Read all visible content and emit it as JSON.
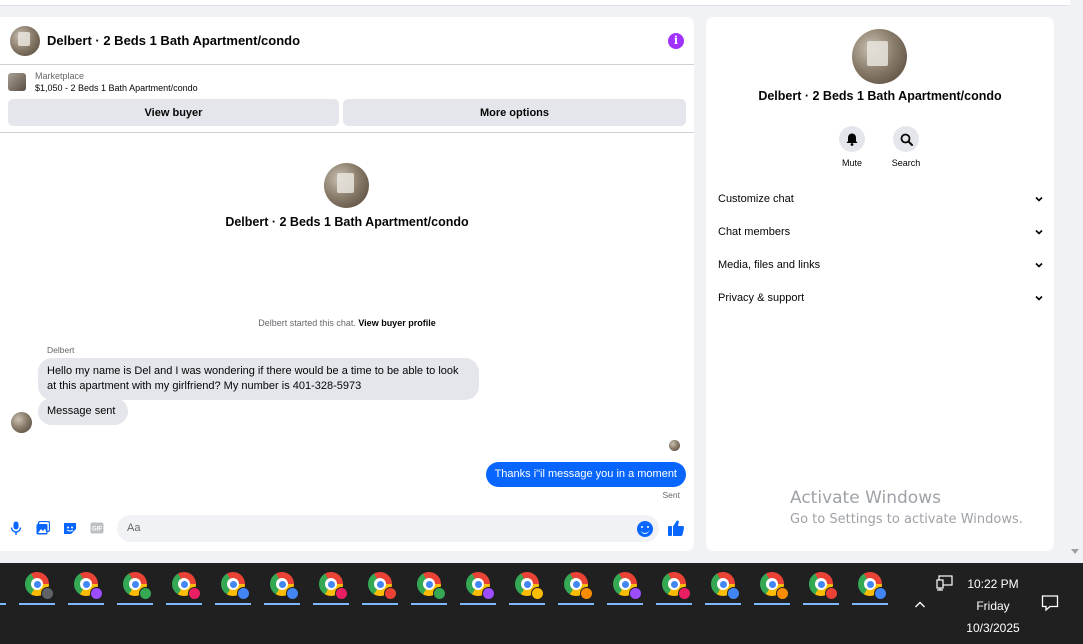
{
  "chat": {
    "header_title": "Delbert · 2 Beds 1 Bath Apartment/condo",
    "marketplace_label": "Marketplace",
    "listing": "$1,050 - 2 Beds 1 Bath Apartment/condo",
    "view_buyer": "View buyer",
    "more_options": "More options",
    "intro_title": "Delbert · 2 Beds 1 Bath Apartment/condo",
    "started_text": "Delbert started this chat.",
    "view_buyer_profile": "View buyer profile",
    "sender_name": "Delbert",
    "messages": [
      {
        "text": "Hello my name is Del and I was wondering if there would be a time to be able to look at this apartment with my girlfriend?  My number is 401-328-5973"
      },
      {
        "text": "Message sent"
      },
      {
        "text": "Thanks i\"il message you in a moment"
      }
    ],
    "sent_label": "Sent",
    "input_placeholder": "Aa"
  },
  "info_panel": {
    "title": "Delbert · 2 Beds 1 Bath Apartment/condo",
    "actions": [
      "Mute",
      "Search"
    ],
    "sections": [
      "Customize chat",
      "Chat members",
      "Media, files and links",
      "Privacy & support"
    ]
  },
  "watermark": {
    "line1": "Activate Windows",
    "line2": "Go to Settings to activate Windows."
  },
  "taskbar": {
    "app_count": 18,
    "badge_colors": [
      "#5f6368",
      "#9b4dff",
      "#34a853",
      "#e91e63",
      "#4285f4",
      "#4285f4",
      "#e91e63",
      "#ea4335",
      "#34a853",
      "#9b4dff",
      "#fbbc05",
      "#fb8c00",
      "#9b4dff",
      "#e91e63",
      "#4285f4",
      "#fb8c00",
      "#ea4335",
      "#4285f4"
    ],
    "time": "10:22 PM",
    "day": "Friday",
    "date": "10/3/2025"
  },
  "colors": {
    "accent": "#0866ff",
    "info": "#a033ff",
    "taskbar": "#202020"
  }
}
